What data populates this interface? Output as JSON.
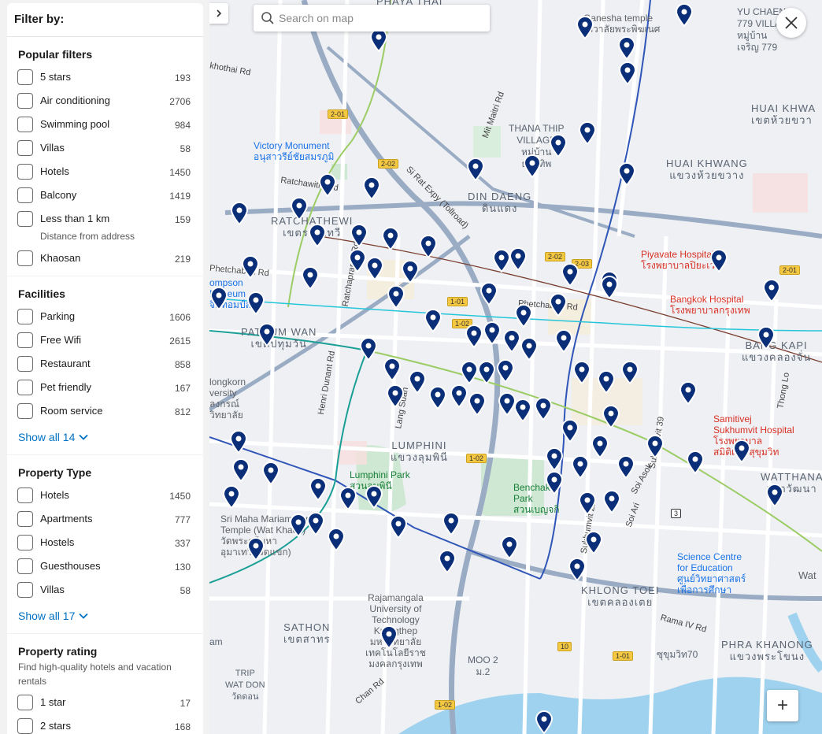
{
  "filter_header": "Filter by:",
  "sections": {
    "popular": {
      "title": "Popular filters",
      "items": [
        {
          "label": "5 stars",
          "count": "193"
        },
        {
          "label": "Air conditioning",
          "count": "2706"
        },
        {
          "label": "Swimming pool",
          "count": "984"
        },
        {
          "label": "Villas",
          "count": "58"
        },
        {
          "label": "Hotels",
          "count": "1450"
        },
        {
          "label": "Balcony",
          "count": "1419"
        },
        {
          "label": "Less than 1 km",
          "count": "159",
          "sub": "Distance from address"
        },
        {
          "label": "Khaosan",
          "count": "219"
        }
      ]
    },
    "facilities": {
      "title": "Facilities",
      "items": [
        {
          "label": "Parking",
          "count": "1606"
        },
        {
          "label": "Free Wifi",
          "count": "2615"
        },
        {
          "label": "Restaurant",
          "count": "858"
        },
        {
          "label": "Pet friendly",
          "count": "167"
        },
        {
          "label": "Room service",
          "count": "812"
        }
      ],
      "show_all": "Show all 14"
    },
    "property_type": {
      "title": "Property Type",
      "items": [
        {
          "label": "Hotels",
          "count": "1450"
        },
        {
          "label": "Apartments",
          "count": "777"
        },
        {
          "label": "Hostels",
          "count": "337"
        },
        {
          "label": "Guesthouses",
          "count": "130"
        },
        {
          "label": "Villas",
          "count": "58"
        }
      ],
      "show_all": "Show all 17"
    },
    "rating": {
      "title": "Property rating",
      "desc": "Find high-quality hotels and vacation rentals",
      "items": [
        {
          "label": "1 star",
          "count": "17"
        },
        {
          "label": "2 stars",
          "count": "168"
        }
      ]
    }
  },
  "map": {
    "search_placeholder": "Search on map",
    "zoom_in": "+",
    "labels": {
      "phaya_thai": "PHAYA THAI",
      "yu_chaeng": "YU CHAENG\n779 VILLA\nหมู่บ้าน\nเจริญ 779",
      "ganesha": "Ganesha temple\nเทวาลัยพระพิฆเนศ",
      "thana_thip": "THANA THIP\nVILLAGE\nหมู่บ้าน\nธนาทิพ",
      "huai_khwang": "HUAI KHWANG\nแขวงห้วยขวาง",
      "huai_khwa_district": "HUAI KHWA\nเขตห้วยขวา",
      "din_daeng": "DIN DAENG\nดินแดง",
      "victory": "Victory Monument\nอนุสาวรีย์ชัยสมรภูมิ",
      "ratchathewi": "RATCHATHEWI\nเขตราชเทวี",
      "piyavate": "Piyavate Hospital\nโรงพยาบาลปิยะเวท",
      "bangkok_hospital": "Bangkok Hospital\nโรงพยาบาลกรุงเทพ",
      "thompson": "ompson\nMuseum\nจิมทอมป์สัน",
      "pathum_wan": "PATHUM WAN\nเขตปทุมวัน",
      "bang_kapi": "BANG KAPI\nแขวงคลองจั่น",
      "chulalongkorn": "longkorn\nversity\nลงกรณ์\nวิทยาลัย",
      "samitivej": "Samitivej\nSukhumvit Hospital\nโรงพยาบาล\nสมิติเวช สุขุมวิท",
      "lumphini": "LUMPHINI\nแขวงลุมพินี",
      "lumphini_park": "Lumphini Park\nสวนลุมพินี",
      "benchakiti": "Benchaki\nPark\nสวนเบญจกิ",
      "watthana": "WATTHANA\nเขตวัฒนา",
      "sri_maha": "Sri Maha Mariamman\nTemple (Wat Khaek)\nวัดพระศรีมหา\nอุมาเทวี (วัดแขก)",
      "science_centre": "Science Centre\nfor Education\nศูนย์วิทยาศาสตร์\nเพื่อการศึกษา",
      "wat": "Wat",
      "khlong_toei": "KHLONG TOEI\nเขตคลองเตย",
      "rajamangala": "Rajamangala\nUniversity of\nTechnology\nKrungthep\nมหาวิทยาลัย\nเทคโนโลยีราช\nมงคลกรุงเทพ",
      "sathon": "SATHON\nเขตสาทร",
      "phra_khanong": "PHRA KHANONG\nแขวงพระโขนง",
      "moo2": "MOO 2\nม.2",
      "wat_don": "TRIP\nWAT DON\nวัดดอน",
      "am": "am",
      "sukhumvit70": "ซุขุมวิท70"
    },
    "roads": {
      "mittmaitri": "Mit Maitri Rd",
      "ratchawithi": "Ratchawithi Rd",
      "sirat": "Si Rat Expy (Tollroad)",
      "phetchaburi": "Phetchaburi Rd",
      "phetchaburi2": "Phetchaburi Rd",
      "henri_dunant": "Henri Dunant Rd",
      "rama4": "Rama IV Rd",
      "chan": "Chan Rd",
      "thong_lo": "Thong Lo",
      "sukhumvit39": "Sukhumvit 39",
      "soi_asok": "Soi Asok",
      "soi_ari": "Soi Ari",
      "sukhumvit22": "Sukhumvit 22",
      "khothai": "khothai Rd",
      "ratchaprarop": "Ratchaprarop Rd",
      "lang_suan": "Lang Suan"
    },
    "shields": [
      "2-01",
      "2-02",
      "2-02",
      "2-03",
      "2-01",
      "1-01",
      "1-02",
      "1-02",
      "10",
      "1-01",
      "1-02",
      "3"
    ]
  }
}
